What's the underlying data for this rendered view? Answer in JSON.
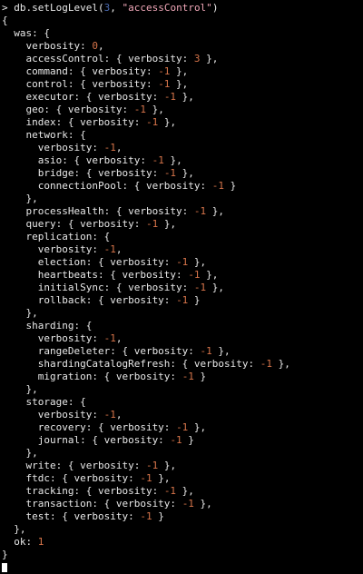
{
  "terminal": {
    "colors": {
      "background": "#000000",
      "text": "#e8e8e8",
      "number": "#d6744a",
      "string": "#f0a7b8",
      "dim_number": "#4a6ab0"
    },
    "lines": [
      [
        {
          "t": "> db.setLogLevel("
        },
        {
          "t": "3",
          "c": "dim"
        },
        {
          "t": ", "
        },
        {
          "t": "\"accessControl\"",
          "c": "str"
        },
        {
          "t": ")"
        }
      ],
      [
        {
          "t": "{"
        }
      ],
      [
        {
          "t": "  was: {"
        }
      ],
      [
        {
          "t": "    verbosity: "
        },
        {
          "t": "0",
          "c": "num"
        },
        {
          "t": ","
        }
      ],
      [
        {
          "t": "    accessControl: { verbosity: "
        },
        {
          "t": "3",
          "c": "num"
        },
        {
          "t": " },"
        }
      ],
      [
        {
          "t": "    command: { verbosity: "
        },
        {
          "t": "-1",
          "c": "num"
        },
        {
          "t": " },"
        }
      ],
      [
        {
          "t": "    control: { verbosity: "
        },
        {
          "t": "-1",
          "c": "num"
        },
        {
          "t": " },"
        }
      ],
      [
        {
          "t": "    executor: { verbosity: "
        },
        {
          "t": "-1",
          "c": "num"
        },
        {
          "t": " },"
        }
      ],
      [
        {
          "t": "    geo: { verbosity: "
        },
        {
          "t": "-1",
          "c": "num"
        },
        {
          "t": " },"
        }
      ],
      [
        {
          "t": "    index: { verbosity: "
        },
        {
          "t": "-1",
          "c": "num"
        },
        {
          "t": " },"
        }
      ],
      [
        {
          "t": "    network: {"
        }
      ],
      [
        {
          "t": "      verbosity: "
        },
        {
          "t": "-1",
          "c": "num"
        },
        {
          "t": ","
        }
      ],
      [
        {
          "t": "      asio: { verbosity: "
        },
        {
          "t": "-1",
          "c": "num"
        },
        {
          "t": " },"
        }
      ],
      [
        {
          "t": "      bridge: { verbosity: "
        },
        {
          "t": "-1",
          "c": "num"
        },
        {
          "t": " },"
        }
      ],
      [
        {
          "t": "      connectionPool: { verbosity: "
        },
        {
          "t": "-1",
          "c": "num"
        },
        {
          "t": " }"
        }
      ],
      [
        {
          "t": "    },"
        }
      ],
      [
        {
          "t": "    processHealth: { verbosity: "
        },
        {
          "t": "-1",
          "c": "num"
        },
        {
          "t": " },"
        }
      ],
      [
        {
          "t": "    query: { verbosity: "
        },
        {
          "t": "-1",
          "c": "num"
        },
        {
          "t": " },"
        }
      ],
      [
        {
          "t": "    replication: {"
        }
      ],
      [
        {
          "t": "      verbosity: "
        },
        {
          "t": "-1",
          "c": "num"
        },
        {
          "t": ","
        }
      ],
      [
        {
          "t": "      election: { verbosity: "
        },
        {
          "t": "-1",
          "c": "num"
        },
        {
          "t": " },"
        }
      ],
      [
        {
          "t": "      heartbeats: { verbosity: "
        },
        {
          "t": "-1",
          "c": "num"
        },
        {
          "t": " },"
        }
      ],
      [
        {
          "t": "      initialSync: { verbosity: "
        },
        {
          "t": "-1",
          "c": "num"
        },
        {
          "t": " },"
        }
      ],
      [
        {
          "t": "      rollback: { verbosity: "
        },
        {
          "t": "-1",
          "c": "num"
        },
        {
          "t": " }"
        }
      ],
      [
        {
          "t": "    },"
        }
      ],
      [
        {
          "t": "    sharding: {"
        }
      ],
      [
        {
          "t": "      verbosity: "
        },
        {
          "t": "-1",
          "c": "num"
        },
        {
          "t": ","
        }
      ],
      [
        {
          "t": "      rangeDeleter: { verbosity: "
        },
        {
          "t": "-1",
          "c": "num"
        },
        {
          "t": " },"
        }
      ],
      [
        {
          "t": "      shardingCatalogRefresh: { verbosity: "
        },
        {
          "t": "-1",
          "c": "num"
        },
        {
          "t": " },"
        }
      ],
      [
        {
          "t": "      migration: { verbosity: "
        },
        {
          "t": "-1",
          "c": "num"
        },
        {
          "t": " }"
        }
      ],
      [
        {
          "t": "    },"
        }
      ],
      [
        {
          "t": "    storage: {"
        }
      ],
      [
        {
          "t": "      verbosity: "
        },
        {
          "t": "-1",
          "c": "num"
        },
        {
          "t": ","
        }
      ],
      [
        {
          "t": "      recovery: { verbosity: "
        },
        {
          "t": "-1",
          "c": "num"
        },
        {
          "t": " },"
        }
      ],
      [
        {
          "t": "      journal: { verbosity: "
        },
        {
          "t": "-1",
          "c": "num"
        },
        {
          "t": " }"
        }
      ],
      [
        {
          "t": "    },"
        }
      ],
      [
        {
          "t": "    write: { verbosity: "
        },
        {
          "t": "-1",
          "c": "num"
        },
        {
          "t": " },"
        }
      ],
      [
        {
          "t": "    ftdc: { verbosity: "
        },
        {
          "t": "-1",
          "c": "num"
        },
        {
          "t": " },"
        }
      ],
      [
        {
          "t": "    tracking: { verbosity: "
        },
        {
          "t": "-1",
          "c": "num"
        },
        {
          "t": " },"
        }
      ],
      [
        {
          "t": "    transaction: { verbosity: "
        },
        {
          "t": "-1",
          "c": "num"
        },
        {
          "t": " },"
        }
      ],
      [
        {
          "t": "    test: { verbosity: "
        },
        {
          "t": "-1",
          "c": "num"
        },
        {
          "t": " }"
        }
      ],
      [
        {
          "t": "  },"
        }
      ],
      [
        {
          "t": "  ok: "
        },
        {
          "t": "1",
          "c": "num"
        }
      ],
      [
        {
          "t": "}"
        }
      ]
    ]
  }
}
